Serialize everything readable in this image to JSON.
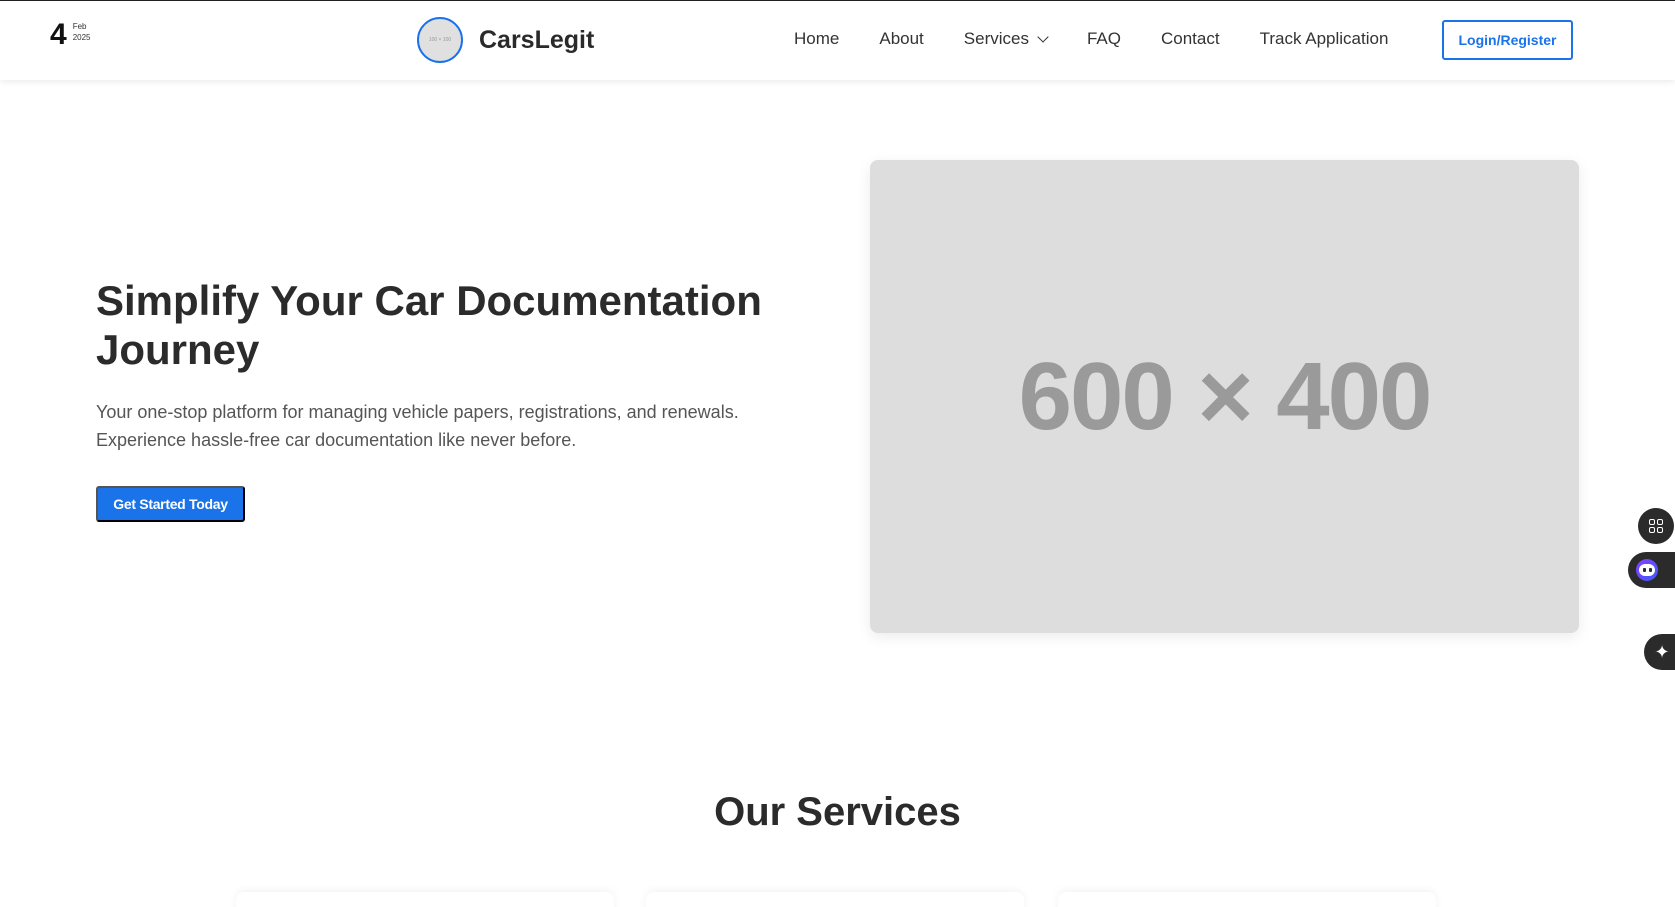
{
  "date": {
    "day": "4",
    "month": "Feb",
    "year": "2025"
  },
  "brand": {
    "name": "CarsLegit",
    "logo_placeholder": "100 × 100"
  },
  "nav": {
    "items": [
      {
        "label": "Home"
      },
      {
        "label": "About"
      },
      {
        "label": "Services"
      },
      {
        "label": "FAQ"
      },
      {
        "label": "Contact"
      },
      {
        "label": "Track Application"
      }
    ],
    "login_label": "Login/Register"
  },
  "hero": {
    "title": "Simplify Your Car Documentation Journey",
    "subtitle": "Your one-stop platform for managing vehicle papers, registrations, and renewals. Experience hassle-free car documentation like never before.",
    "cta_label": "Get Started Today",
    "image_placeholder": "600 × 400"
  },
  "services": {
    "title": "Our Services"
  },
  "widgets": {
    "sparkle_glyph": "✦"
  },
  "colors": {
    "accent": "#1a73e8",
    "placeholder_bg": "#dddddd",
    "text_dark": "#2b2b2b"
  }
}
